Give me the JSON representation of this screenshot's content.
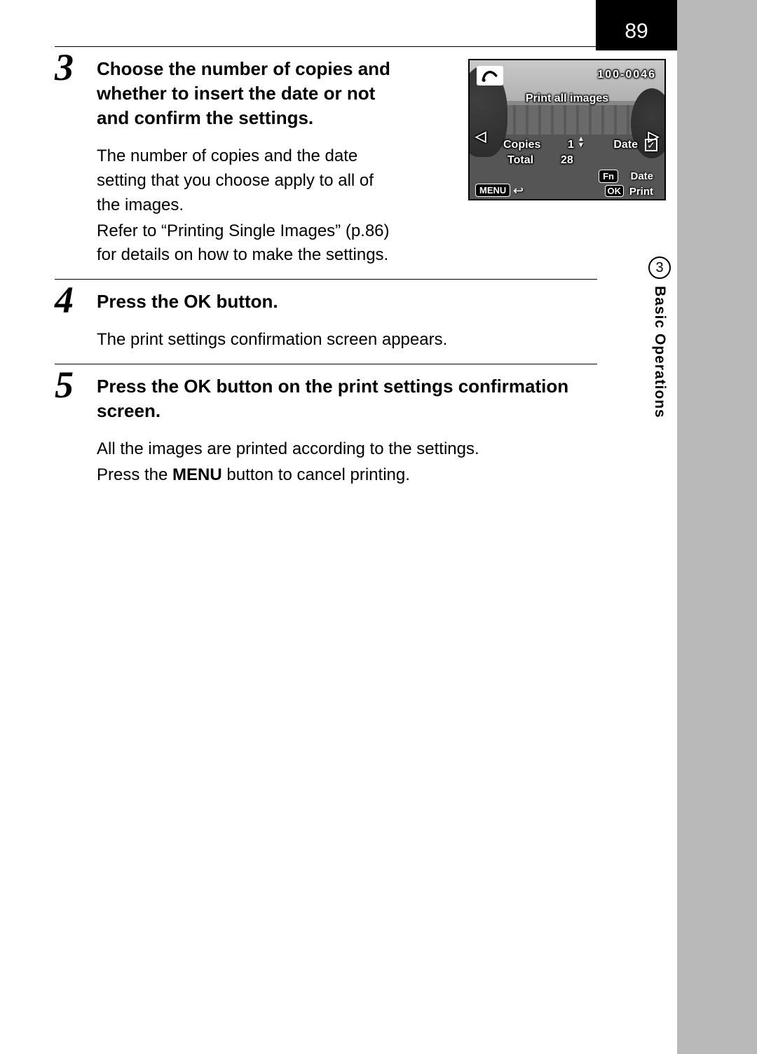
{
  "page_number": "89",
  "sidebar": {
    "chapter_number": "3",
    "chapter_title": "Basic Operations"
  },
  "steps": [
    {
      "num": "3",
      "title": "Choose the number of copies and whether to insert the date or not and confirm the settings.",
      "body1": "The number of copies and the date setting that you choose apply to all of the images.",
      "body2": "Refer to “Printing Single Images” (p.86) for details on how to make the settings."
    },
    {
      "num": "4",
      "title_pre": "Press the ",
      "title_ok": "OK",
      "title_post": " button.",
      "body1": "The print settings confirmation screen appears."
    },
    {
      "num": "5",
      "title_pre": "Press the ",
      "title_ok": "OK",
      "title_post": " button on the print settings confirmation screen.",
      "body1": "All the images are printed according to the settings.",
      "body2_pre": "Press the ",
      "body2_menu": "MENU",
      "body2_post": " button to cancel printing."
    }
  ],
  "lcd": {
    "file_number": "100-0046",
    "header": "Print all images",
    "copies_label": "Copies",
    "copies_value": "1",
    "date_label": "Date",
    "date_checked": "✓",
    "total_label": "Total",
    "total_value": "28",
    "fn_label": "Fn",
    "fn_action": "Date",
    "menu_label": "MENU",
    "menu_back_glyph": "↩",
    "ok_label": "OK",
    "ok_action": "Print",
    "tri_left": "◁",
    "tri_right": "▷",
    "up": "▲",
    "down": "▼"
  }
}
